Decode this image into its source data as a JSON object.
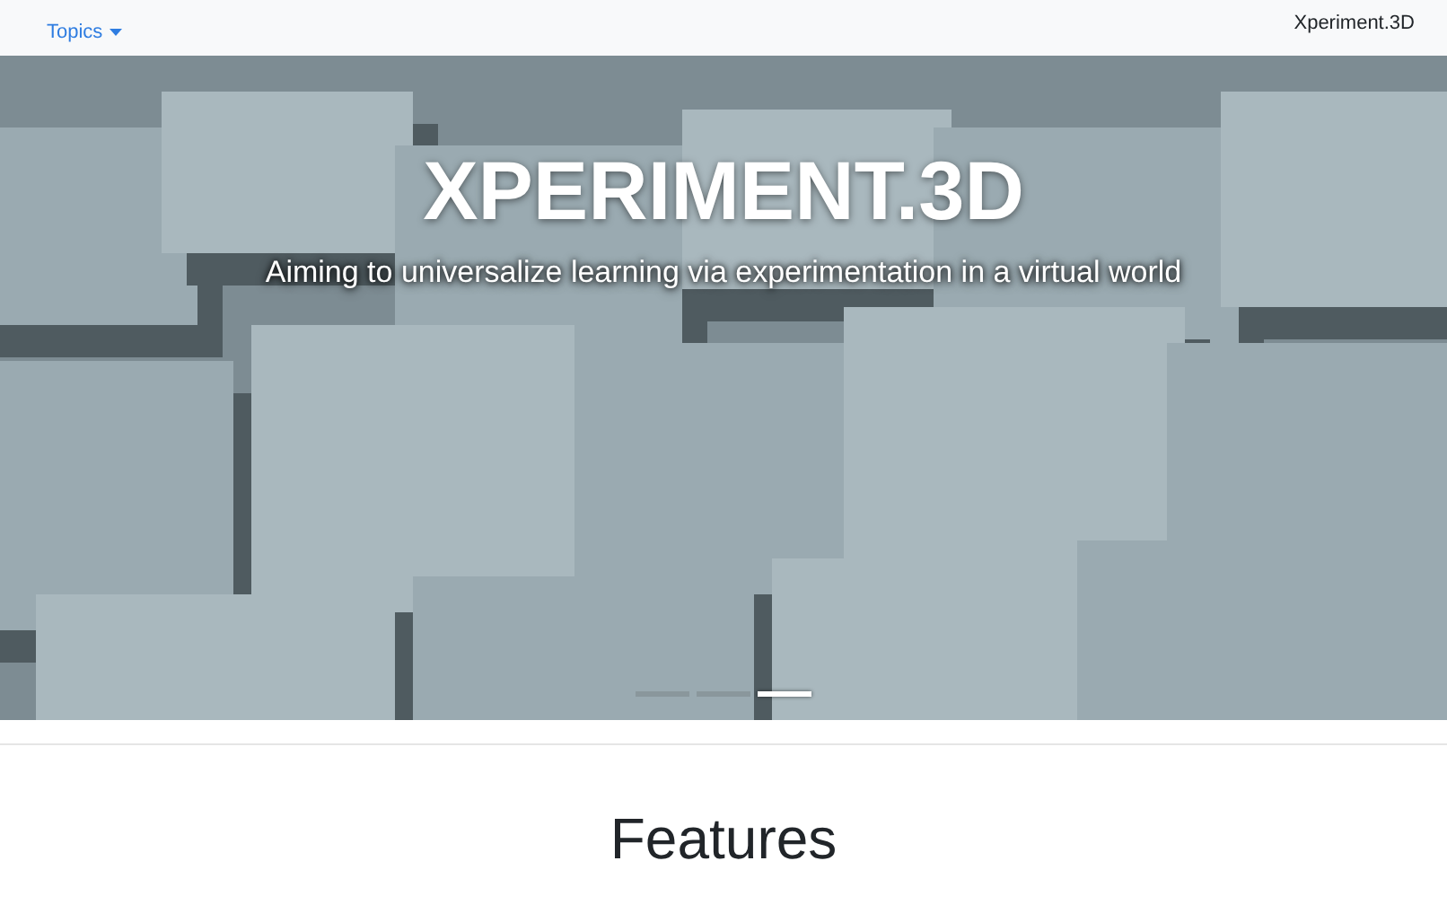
{
  "navbar": {
    "menu": {
      "label": "Topics",
      "expanded": false
    },
    "brand": "Xperiment.3D"
  },
  "hero": {
    "kind": "picture",
    "title": "XPERIMENT.3D",
    "subtitle": "Aiming to universalize learning via experimentation in a virtual world",
    "indicators": [
      {
        "selected": false
      },
      {
        "selected": false
      },
      {
        "selected": true
      }
    ]
  },
  "features": {
    "heading": "Features"
  }
}
